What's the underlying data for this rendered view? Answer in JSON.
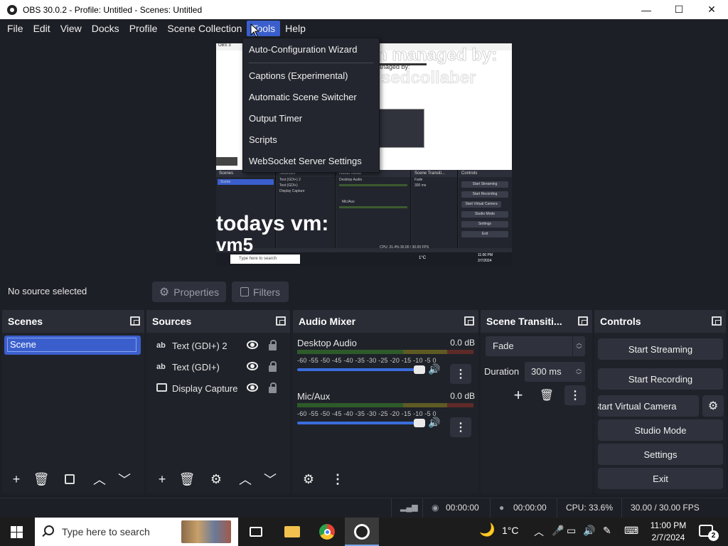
{
  "window": {
    "title": "OBS 30.0.2 - Profile: Untitled - Scenes: Untitled",
    "minimize": "—",
    "maximize": "☐",
    "close": "✕"
  },
  "menubar": [
    "File",
    "Edit",
    "View",
    "Docks",
    "Profile",
    "Scene Collection",
    "Tools",
    "Help"
  ],
  "tools_menu": {
    "items": [
      "Auto-Configuration Wizard",
      "Captions (Experimental)",
      "Automatic Scene Switcher",
      "Output Timer",
      "Scripts",
      "WebSocket Server Settings"
    ]
  },
  "preview": {
    "overlay_line1": "n managed by:",
    "overlay_line2": "sedcollaber",
    "small_title": "OBS 3",
    "small_managed": "anaged by:",
    "caption_line1": "todays vm:",
    "caption_line2": "vm5",
    "mini_docks": [
      "Scenes",
      "Sources",
      "Audio Mixer",
      "Scene Transiti...",
      "Controls"
    ],
    "mini_scene": "Scene",
    "mini_sources": [
      "Text (GDI+) 2",
      "Text (GDI+)",
      "Display Capture"
    ],
    "mini_audio": [
      "Desktop Audio",
      "Mic/Aux"
    ],
    "mini_transition": "Fade",
    "mini_duration": "300 ms",
    "mini_controls": [
      "Start Streaming",
      "Start Recording",
      "Start Virtual Camera",
      "Studio Mode",
      "Settings",
      "Exit"
    ],
    "mini_search": "Type here to search",
    "mini_temp": "1°C",
    "mini_time": "11:00 PM",
    "mini_date": "2/7/2024",
    "mini_status": "CPU: 31.4%  30.00 / 30.00 FPS"
  },
  "source_toolbar": {
    "no_source": "No source selected",
    "properties": "Properties",
    "filters": "Filters"
  },
  "scenes": {
    "title": "Scenes",
    "items": [
      "Scene"
    ]
  },
  "sources": {
    "title": "Sources",
    "items": [
      {
        "type": "ab",
        "label": "Text (GDI+) 2"
      },
      {
        "type": "ab",
        "label": "Text (GDI+)"
      },
      {
        "type": "monitor",
        "label": "Display Capture"
      }
    ]
  },
  "audio_mixer": {
    "title": "Audio Mixer",
    "channels": [
      {
        "name": "Desktop Audio",
        "db": "0.0 dB",
        "volume_fraction": 0.97
      },
      {
        "name": "Mic/Aux",
        "db": "0.0 dB",
        "volume_fraction": 0.97
      }
    ],
    "ticks": "-60 -55 -50 -45 -40 -35 -30 -25 -20 -15 -10 -5  0"
  },
  "transitions": {
    "title": "Scene Transiti...",
    "selected": "Fade",
    "duration_label": "Duration",
    "duration_value": "300 ms"
  },
  "controls": {
    "title": "Controls",
    "start_streaming": "Start Streaming",
    "start_recording": "Start Recording",
    "start_virtual_camera": "Start Virtual Camera",
    "studio_mode": "Studio Mode",
    "settings": "Settings",
    "exit": "Exit"
  },
  "statusbar": {
    "stream_time": "00:00:00",
    "record_time": "00:00:00",
    "cpu": "CPU: 33.6%",
    "fps": "30.00 / 30.00 FPS"
  },
  "taskbar": {
    "search_placeholder": "Type here to search",
    "temperature": "1°C",
    "time": "11:00 PM",
    "date": "2/7/2024",
    "notifications": "2"
  },
  "colors": {
    "accent": "#3a5fcd",
    "background": "#1d1f26",
    "dock": "#1f2229",
    "button": "#2f323c"
  }
}
